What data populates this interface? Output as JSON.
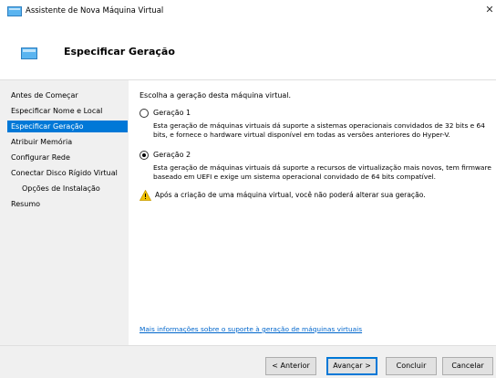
{
  "window": {
    "title": "Assistente de Nova Máquina Virtual",
    "close_glyph": "✕"
  },
  "header": {
    "title": "Especificar Geração"
  },
  "sidebar": {
    "items": [
      {
        "label": "Antes de Começar",
        "selected": false,
        "indented": false
      },
      {
        "label": "Especificar Nome e Local",
        "selected": false,
        "indented": false
      },
      {
        "label": "Especificar Geração",
        "selected": true,
        "indented": false
      },
      {
        "label": "Atribuir Memória",
        "selected": false,
        "indented": false
      },
      {
        "label": "Configurar Rede",
        "selected": false,
        "indented": false
      },
      {
        "label": "Conectar Disco Rígido Virtual",
        "selected": false,
        "indented": false
      },
      {
        "label": "Opções de Instalação",
        "selected": false,
        "indented": true
      },
      {
        "label": "Resumo",
        "selected": false,
        "indented": false
      }
    ]
  },
  "content": {
    "intro": "Escolha a geração desta máquina virtual.",
    "gen1": {
      "label": "Geração 1",
      "checked": false,
      "description": "Esta geração de máquinas virtuais dá suporte a sistemas operacionais convidados de 32 bits e 64 bits, e fornece o hardware virtual disponível em todas as versões anteriores do Hyper-V."
    },
    "gen2": {
      "label": "Geração 2",
      "checked": true,
      "description": "Esta geração de máquinas virtuais dá suporte a recursos de virtualização mais novos, tem firmware baseado em UEFI e exige um sistema operacional convidado de 64 bits compatível."
    },
    "warning": "Após a criação de uma máquina virtual, você não poderá alterar sua geração.",
    "more_link": "Mais informações sobre o suporte à geração de máquinas virtuais"
  },
  "footer": {
    "previous": "< Anterior",
    "next": "Avançar >",
    "finish": "Concluir",
    "cancel": "Cancelar"
  },
  "colors": {
    "accent": "#0078d7",
    "link": "#0066cc",
    "warning": "#f2c200"
  },
  "icons": {
    "app": "hyper-v-window-icon",
    "header": "hyper-v-window-icon",
    "warning": "warning-triangle-icon"
  }
}
